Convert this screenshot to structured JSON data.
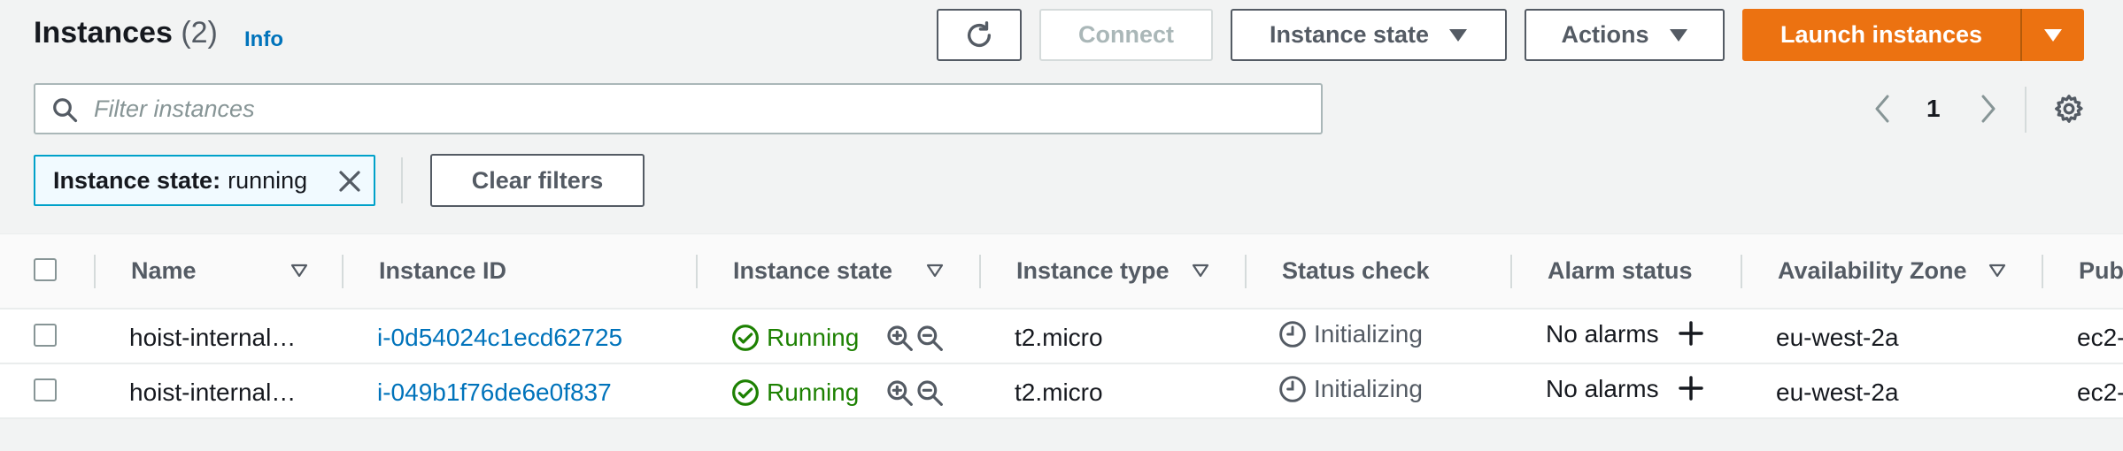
{
  "header": {
    "title": "Instances",
    "count": "(2)",
    "info_label": "Info"
  },
  "toolbar": {
    "refresh_icon": "refresh-icon",
    "connect_label": "Connect",
    "instance_state_label": "Instance state",
    "actions_label": "Actions",
    "launch_label": "Launch instances"
  },
  "filter": {
    "placeholder": "Filter instances",
    "value": ""
  },
  "pagination": {
    "current_page": "1"
  },
  "token": {
    "key": "Instance state:",
    "value": "running"
  },
  "clear_filters_label": "Clear filters",
  "columns": {
    "name": "Name",
    "instance_id": "Instance ID",
    "instance_state": "Instance state",
    "instance_type": "Instance type",
    "status_check": "Status check",
    "alarm_status": "Alarm status",
    "availability_zone": "Availability Zone",
    "public": "Pub"
  },
  "rows": [
    {
      "name": "hoist-internal…",
      "instance_id": "i-0d54024c1ecd62725",
      "state": "Running",
      "type": "t2.micro",
      "status": "Initializing",
      "alarm": "No alarms",
      "az": "eu-west-2a",
      "public": "ec2-"
    },
    {
      "name": "hoist-internal…",
      "instance_id": "i-049b1f76de6e0f837",
      "state": "Running",
      "type": "t2.micro",
      "status": "Initializing",
      "alarm": "No alarms",
      "az": "eu-west-2a",
      "public": "ec2-"
    }
  ],
  "colors": {
    "primary": "#ec7211",
    "link": "#0073bb",
    "success": "#1d8102",
    "token_border": "#00a1c9"
  }
}
